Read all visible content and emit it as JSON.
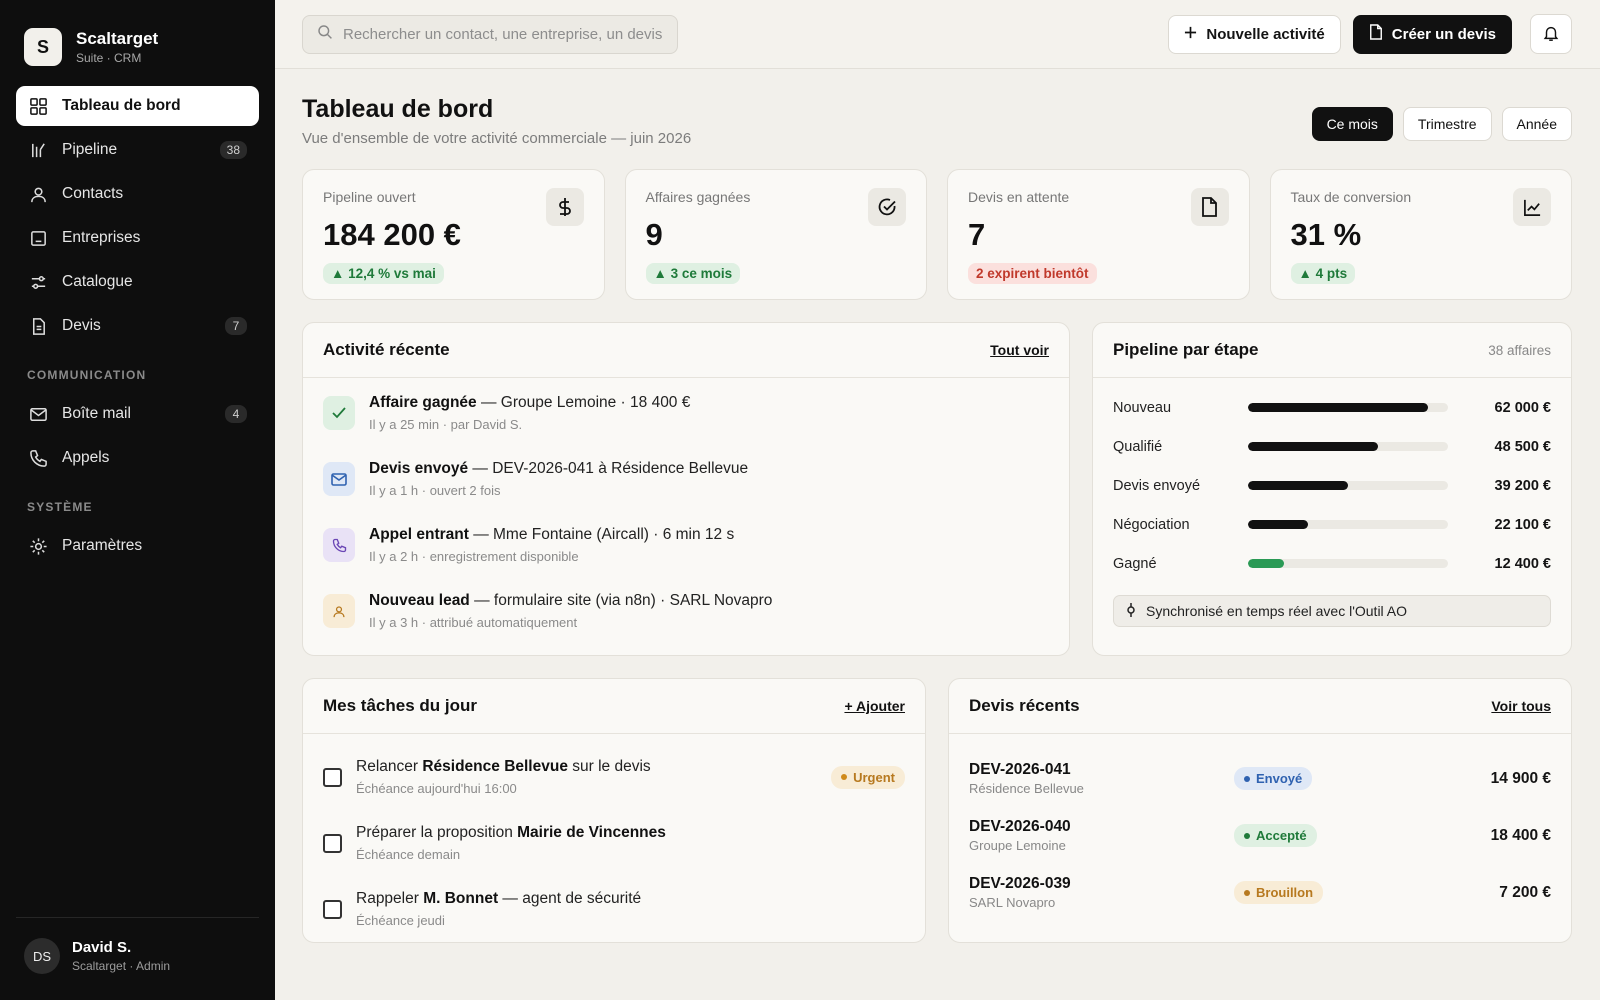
{
  "brand": {
    "initial": "S",
    "name": "Scaltarget",
    "sub": "Suite · CRM"
  },
  "nav": {
    "items": [
      {
        "label": "Tableau de bord",
        "icon": "dashboard-icon",
        "active": true
      },
      {
        "label": "Pipeline",
        "icon": "pipeline-icon",
        "badge": "38"
      },
      {
        "label": "Contacts",
        "icon": "user-icon"
      },
      {
        "label": "Entreprises",
        "icon": "building-icon"
      },
      {
        "label": "Catalogue",
        "icon": "sliders-icon"
      },
      {
        "label": "Devis",
        "icon": "file-icon",
        "badge": "7"
      }
    ],
    "section_communication": "COMMUNICATION",
    "communication": [
      {
        "label": "Boîte mail",
        "icon": "mail-icon",
        "badge": "4"
      },
      {
        "label": "Appels",
        "icon": "phone-icon"
      }
    ],
    "section_system": "SYSTÈME",
    "system": [
      {
        "label": "Paramètres",
        "icon": "gear-icon"
      }
    ]
  },
  "user": {
    "initials": "DS",
    "name": "David S.",
    "role": "Scaltarget · Admin"
  },
  "topbar": {
    "search_placeholder": "Rechercher un contact, une entreprise, un devis…",
    "new_activity": "Nouvelle activité",
    "create_quote": "Créer un devis"
  },
  "page": {
    "title": "Tableau de bord",
    "subtitle": "Vue d'ensemble de votre activité commerciale — juin 2026",
    "periods": [
      "Ce mois",
      "Trimestre",
      "Année"
    ],
    "active_period": "Ce mois"
  },
  "kpis": [
    {
      "label": "Pipeline ouvert",
      "value": "184 200 €",
      "delta": "▲ 12,4 % vs mai",
      "tone": "up",
      "icon": "dollar-icon"
    },
    {
      "label": "Affaires gagnées",
      "value": "9",
      "delta": "▲ 3 ce mois",
      "tone": "up",
      "icon": "check-circle-icon"
    },
    {
      "label": "Devis en attente",
      "value": "7",
      "delta": "2 expirent bientôt",
      "tone": "warn",
      "icon": "file-icon"
    },
    {
      "label": "Taux de conversion",
      "value": "31 %",
      "delta": "▲ 4 pts",
      "tone": "up",
      "icon": "chart-line-icon"
    }
  ],
  "activity": {
    "title": "Activité récente",
    "link": "Tout voir",
    "items": [
      {
        "bold": "Affaire gagnée",
        "rest": " — Groupe Lemoine · 18 400 €",
        "sub": "Il y a 25 min · par David S.",
        "icon": "check-icon",
        "color": "#1f7a3a",
        "bg": "#dff0e2"
      },
      {
        "bold": "Devis envoyé",
        "rest": " — DEV-2026-041 à Résidence Bellevue",
        "sub": "Il y a 1 h · ouvert 2 fois",
        "icon": "mail-icon",
        "color": "#2f62b0",
        "bg": "#dfe8f6"
      },
      {
        "bold": "Appel entrant",
        "rest": " — Mme Fontaine (Aircall) · 6 min 12 s",
        "sub": "Il y a 2 h · enregistrement disponible",
        "icon": "phone-icon",
        "color": "#6b47b5",
        "bg": "#e9e2f6"
      },
      {
        "bold": "Nouveau lead",
        "rest": " — formulaire site (via n8n) · SARL Novapro",
        "sub": "Il y a 3 h · attribué automatiquement",
        "icon": "user-icon",
        "color": "#b7791f",
        "bg": "#f8ecd6"
      }
    ]
  },
  "pipeline": {
    "title": "Pipeline par étape",
    "meta": "38 affaires",
    "stages": [
      {
        "name": "Nouveau",
        "value": "62 000 €",
        "fill": 0.9,
        "color": "#111111"
      },
      {
        "name": "Qualifié",
        "value": "48 500 €",
        "fill": 0.65,
        "color": "#111111"
      },
      {
        "name": "Devis envoyé",
        "value": "39 200 €",
        "fill": 0.5,
        "color": "#111111"
      },
      {
        "name": "Négociation",
        "value": "22 100 €",
        "fill": 0.3,
        "color": "#111111"
      },
      {
        "name": "Gagné",
        "value": "12 400 €",
        "fill": 0.18,
        "color": "#2a9a55"
      }
    ],
    "sync": "Synchronisé en temps réel avec l'Outil AO"
  },
  "tasks": {
    "title": "Mes tâches du jour",
    "link": "+ Ajouter",
    "items": [
      {
        "pre": "Relancer ",
        "bold": "Résidence Bellevue",
        "post": " sur le devis",
        "sub": "Échéance aujourd'hui 16:00",
        "tag": "Urgent"
      },
      {
        "pre": "Préparer la proposition ",
        "bold": "Mairie de Vincennes",
        "post": "",
        "sub": "Échéance demain",
        "tag": ""
      },
      {
        "pre": "Rappeler ",
        "bold": "M. Bonnet",
        "post": " — agent de sécurité",
        "sub": "Échéance jeudi",
        "tag": ""
      }
    ]
  },
  "quotes": {
    "title": "Devis récents",
    "link": "Voir tous",
    "items": [
      {
        "id": "DEV-2026-041",
        "client": "Résidence Bellevue",
        "status": "Envoyé",
        "status_color": "#2f62b0",
        "status_bg": "#dfe8f6",
        "amount": "14 900 €"
      },
      {
        "id": "DEV-2026-040",
        "client": "Groupe Lemoine",
        "status": "Accepté",
        "status_color": "#1f7a3a",
        "status_bg": "#dff0e2",
        "amount": "18 400 €"
      },
      {
        "id": "DEV-2026-039",
        "client": "SARL Novapro",
        "status": "Brouillon",
        "status_color": "#b7791f",
        "status_bg": "#f8ecd6",
        "amount": "7 200 €"
      }
    ]
  }
}
